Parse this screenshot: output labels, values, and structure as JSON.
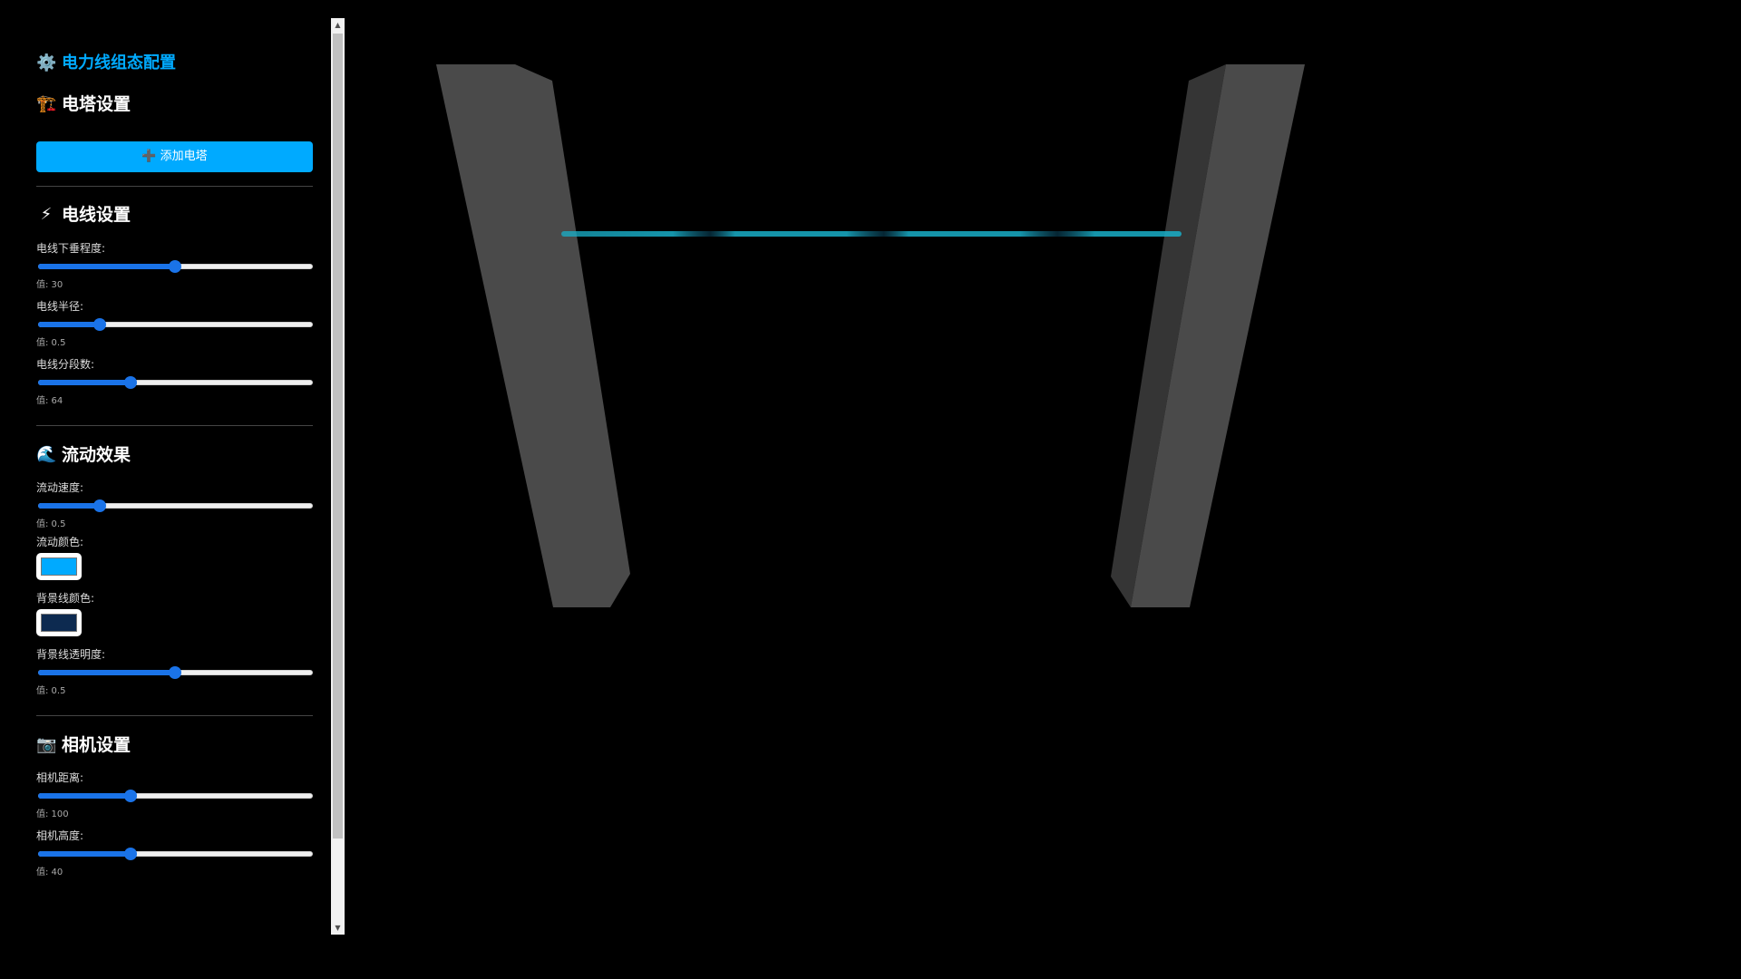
{
  "panel": {
    "title_icon": "⚙️",
    "title": "电力线组态配置",
    "sections": {
      "tower": {
        "icon": "🏗️",
        "title": "电塔设置",
        "add_button": "➕ 添加电塔"
      },
      "wire": {
        "icon": "⚡",
        "title": "电线设置",
        "controls": [
          {
            "label": "电线下垂程度:",
            "value_text": "值: 30",
            "fraction": 0.5
          },
          {
            "label": "电线半径:",
            "value_text": "值: 0.5",
            "fraction": 0.225
          },
          {
            "label": "电线分段数:",
            "value_text": "值: 64",
            "fraction": 0.34
          }
        ]
      },
      "flow": {
        "icon": "🌊",
        "title": "流动效果",
        "speed": {
          "label": "流动速度:",
          "value_text": "值: 0.5",
          "fraction": 0.225
        },
        "flow_color": {
          "label": "流动颜色:",
          "color": "#00aaff"
        },
        "bg_color": {
          "label": "背景线颜色:",
          "color": "#0d2a50"
        },
        "bg_opacity": {
          "label": "背景线透明度:",
          "value_text": "值: 0.5",
          "fraction": 0.5
        }
      },
      "camera": {
        "icon": "📷",
        "title": "相机设置",
        "controls": [
          {
            "label": "相机距离:",
            "value_text": "值: 100",
            "fraction": 0.34
          },
          {
            "label": "相机高度:",
            "value_text": "值: 40",
            "fraction": 0.34
          }
        ]
      }
    }
  },
  "scene": {
    "tower_color": "#4a4a4a",
    "tower_side_color": "#353535",
    "wire_color": "#00d8ff",
    "background": "#000000"
  },
  "scrollbar": {
    "up_arrow": "▲",
    "down_arrow": "▼"
  }
}
